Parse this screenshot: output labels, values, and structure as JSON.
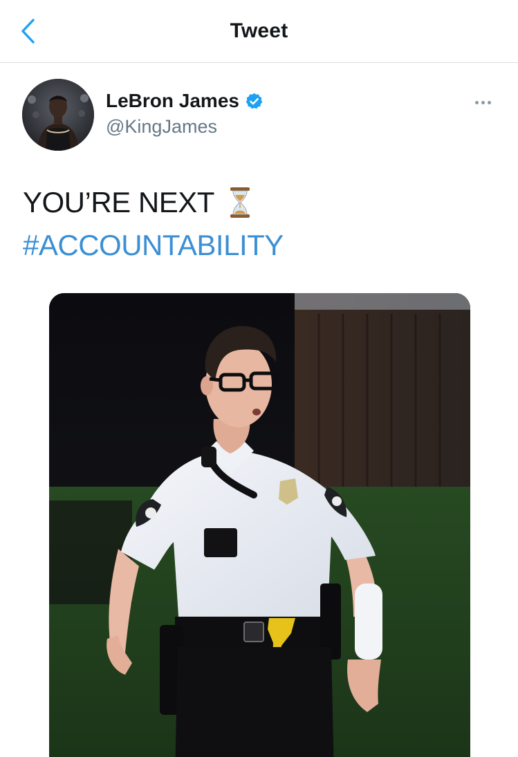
{
  "header": {
    "title": "Tweet",
    "back_icon": "chevron-left-icon"
  },
  "tweet": {
    "author": {
      "display_name": "LeBron James",
      "handle": "@KingJames",
      "verified": true,
      "avatar_icon": "avatar"
    },
    "text_line_1": "YOU’RE NEXT",
    "emoji": "hourglass-icon",
    "hashtag": "#ACCOUNTABILITY",
    "more_icon": "more-icon",
    "media": "video-still"
  },
  "colors": {
    "accent": "#1da1f2",
    "hashtag": "#3b8fd4",
    "text_primary": "#14171a",
    "text_secondary": "#657786",
    "divider": "#d7dde2"
  }
}
